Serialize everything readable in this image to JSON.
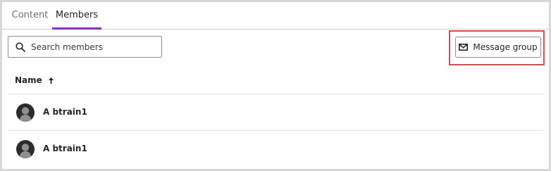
{
  "tabs": [
    {
      "label": "Content",
      "active": false
    },
    {
      "label": "Members",
      "active": true
    }
  ],
  "search": {
    "placeholder": "Search members",
    "value": ""
  },
  "toolbar": {
    "message_group_label": "Message group"
  },
  "table": {
    "columns": [
      {
        "label": "Name",
        "sort": "ascending"
      }
    ],
    "rows": [
      {
        "name": "A btrain1"
      },
      {
        "name": "A btrain1"
      }
    ]
  },
  "colors": {
    "accent": "#8b2fbf",
    "highlight": "#e2474b"
  },
  "icons": [
    "search-icon",
    "mail-icon",
    "sort-ascending-icon",
    "avatar-icon"
  ]
}
